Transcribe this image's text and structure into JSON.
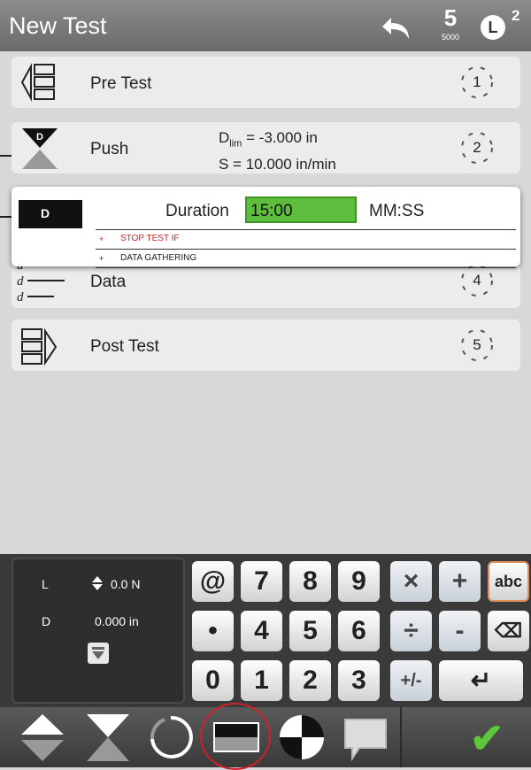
{
  "header": {
    "title": "New Test",
    "mode_value": "5",
    "mode_sub": "5000",
    "load_badge": "L",
    "load_superscript": "2"
  },
  "steps": [
    {
      "label": "Pre Test",
      "number": "1"
    },
    {
      "label": "Push",
      "number": "2",
      "param1_main": "D",
      "param1_sub": "lim",
      "param1_rest": " = -3.000 in",
      "param2": "S = 10.000 in/min"
    },
    {
      "label": "Data",
      "number": "4"
    },
    {
      "label": "Post Test",
      "number": "5"
    }
  ],
  "hold_popup": {
    "icon_letter": "D",
    "duration_label": "Duration",
    "duration_value": "15:00",
    "duration_unit": "MM:SS",
    "stop_test": {
      "symbol": "+",
      "label": "STOP TEST IF"
    },
    "data_gathering": {
      "symbol": "+",
      "label": "DATA GATHERING"
    }
  },
  "readout": {
    "load_label": "L",
    "load_value": "0.0 N",
    "disp_label": "D",
    "disp_value": "0.000 in"
  },
  "keypad": {
    "row1": [
      "@",
      "7",
      "8",
      "9",
      "×",
      "+",
      "abc"
    ],
    "row2": [
      "•",
      "4",
      "5",
      "6",
      "÷",
      "-",
      "⌫"
    ],
    "row3": [
      "0",
      "1",
      "2",
      "3",
      "+/-",
      "↵"
    ]
  },
  "colors": {
    "accent_green": "#5cbe3c",
    "stop_text": "#d02020",
    "highlight_circle": "#d0202a"
  },
  "icons": {
    "undo": "undo-icon",
    "confirm": "checkmark-icon"
  }
}
